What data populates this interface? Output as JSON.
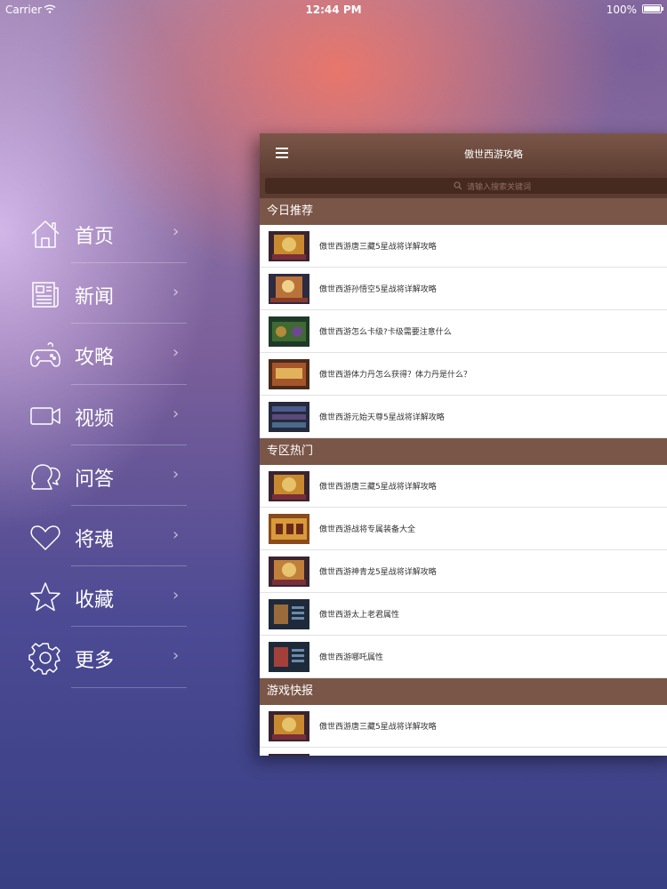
{
  "status_bar": {
    "carrier": "Carrier",
    "time": "12:44 PM",
    "battery": "100%"
  },
  "side_menu": {
    "items": [
      {
        "label": "首页",
        "icon": "home-icon"
      },
      {
        "label": "新闻",
        "icon": "newspaper-icon"
      },
      {
        "label": "攻略",
        "icon": "gamepad-icon"
      },
      {
        "label": "视频",
        "icon": "video-camera-icon"
      },
      {
        "label": "问答",
        "icon": "chat-bubbles-icon"
      },
      {
        "label": "将魂",
        "icon": "heart-icon"
      },
      {
        "label": "收藏",
        "icon": "star-icon"
      },
      {
        "label": "更多",
        "icon": "gear-icon"
      }
    ],
    "chevron": "›"
  },
  "panel": {
    "title": "傲世西游攻略",
    "search_placeholder": "请输入搜索关键词",
    "sections": [
      {
        "title": "今日推荐",
        "items": [
          {
            "text": "傲世西游唐三藏5星战将详解攻略"
          },
          {
            "text": "傲世西游孙悟空5星战将详解攻略"
          },
          {
            "text": "傲世西游怎么卡级?卡级需要注意什么"
          },
          {
            "text": "傲世西游体力丹怎么获得？体力丹是什么？"
          },
          {
            "text": "傲世西游元始天尊5星战将详解攻略"
          }
        ]
      },
      {
        "title": "专区热门",
        "items": [
          {
            "text": "傲世西游唐三藏5星战将详解攻略"
          },
          {
            "text": "傲世西游战将专属装备大全"
          },
          {
            "text": "傲世西游神青龙5星战将详解攻略"
          },
          {
            "text": "傲世西游太上老君属性"
          },
          {
            "text": "傲世西游哪吒属性"
          }
        ]
      },
      {
        "title": "游戏快报",
        "items": [
          {
            "text": "傲世西游唐三藏5星战将详解攻略"
          }
        ]
      }
    ]
  },
  "colors": {
    "nav_brown": "#7a5648",
    "section_brown": "#7a5648",
    "search_dark": "#46291f"
  }
}
